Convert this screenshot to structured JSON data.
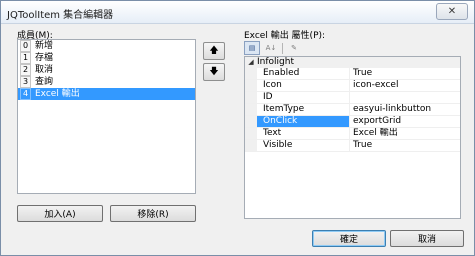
{
  "window": {
    "title": "JQToolItem 集合編輯器",
    "close_glyph": "✕"
  },
  "members": {
    "label": "成員(M):",
    "items": [
      {
        "index": "0",
        "label": "新增"
      },
      {
        "index": "1",
        "label": "存檔"
      },
      {
        "index": "2",
        "label": "取消"
      },
      {
        "index": "3",
        "label": "查詢"
      },
      {
        "index": "4",
        "label": "Excel 輸出"
      }
    ],
    "selected_index": 4,
    "move_up_glyph": "🡅",
    "move_down_glyph": "🡇",
    "add_button": "加入(A)",
    "remove_button": "移除(R)"
  },
  "properties": {
    "label": "Excel 輸出 屬性(P):",
    "toolbar": {
      "categorized_icon": "categorized-icon",
      "alphabetical_icon": "alphabetical-icon",
      "property_pages_icon": "wrench-icon"
    },
    "category": {
      "name": "Infolight",
      "toggle_glyph": "◢"
    },
    "rows": [
      {
        "name": "Enabled",
        "value": "True"
      },
      {
        "name": "Icon",
        "value": "icon-excel"
      },
      {
        "name": "ID",
        "value": ""
      },
      {
        "name": "ItemType",
        "value": "easyui-linkbutton"
      },
      {
        "name": "OnClick",
        "value": "exportGrid"
      },
      {
        "name": "Text",
        "value": "Excel 輸出"
      },
      {
        "name": "Visible",
        "value": "True"
      }
    ],
    "selected_row": "OnClick"
  },
  "footer": {
    "ok_button": "確定",
    "cancel_button": "取消"
  }
}
